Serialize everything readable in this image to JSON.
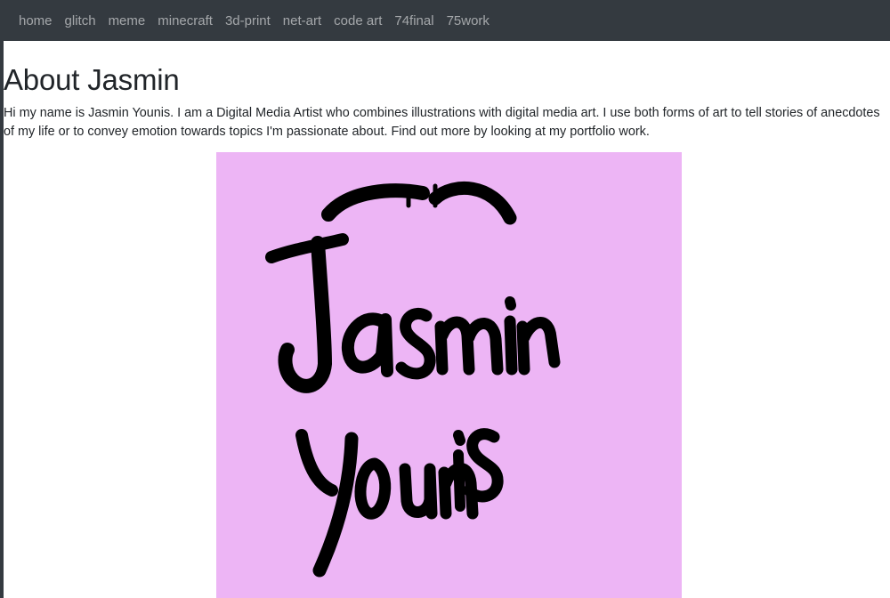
{
  "nav": {
    "items": [
      {
        "label": "home"
      },
      {
        "label": "glitch"
      },
      {
        "label": "meme"
      },
      {
        "label": "minecraft"
      },
      {
        "label": "3d-print"
      },
      {
        "label": "net-art"
      },
      {
        "label": "code art"
      },
      {
        "label": "74final"
      },
      {
        "label": "75work"
      }
    ]
  },
  "main": {
    "title": "About Jasmin",
    "bio": "Hi my name is Jasmin Younis. I am a Digital Media Artist who combines illustrations with digital media art. I use both forms of art to tell stories of anecdotes of my life or to convey emotion towards topics I'm passionate about. Find out more by looking at my portfolio work.",
    "artwork": {
      "lettering": "Jasmin Younis",
      "background": "#edb5f5",
      "ink": "#000000"
    }
  },
  "theme": {
    "navbar_bg": "#343a40",
    "text": "#212529"
  }
}
